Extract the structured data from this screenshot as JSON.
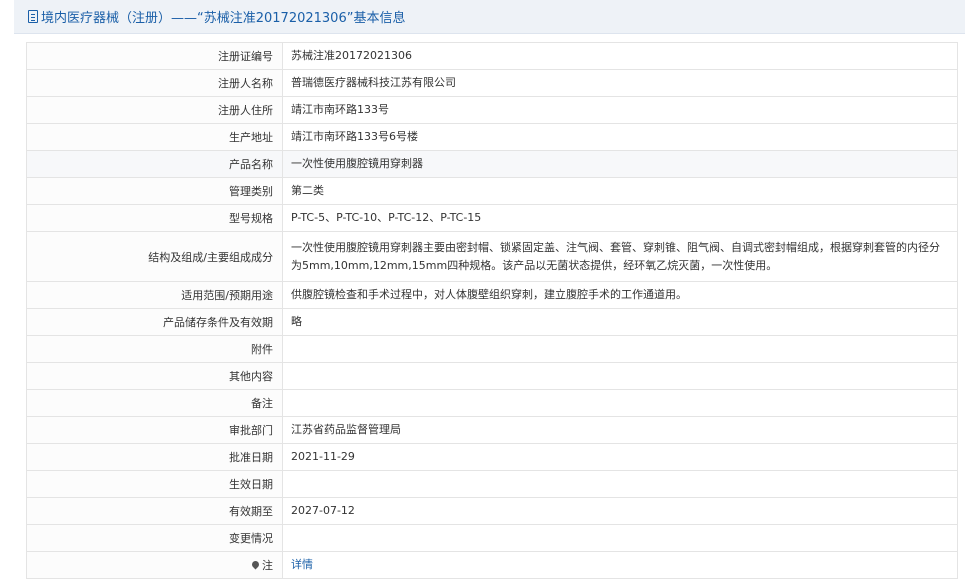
{
  "header": {
    "title": "境内医疗器械（注册）——“苏械注准20172021306”基本信息",
    "icon": "document-icon"
  },
  "rows": [
    {
      "label": "注册证编号",
      "value": "苏械注准20172021306"
    },
    {
      "label": "注册人名称",
      "value": "普瑞德医疗器械科技江苏有限公司"
    },
    {
      "label": "注册人住所",
      "value": "靖江市南环路133号"
    },
    {
      "label": "生产地址",
      "value": "靖江市南环路133号6号楼"
    },
    {
      "label": "产品名称",
      "value": "一次性使用腹腔镜用穿刺器"
    },
    {
      "label": "管理类别",
      "value": "第二类"
    },
    {
      "label": "型号规格",
      "value": "P-TC-5、P-TC-10、P-TC-12、P-TC-15"
    },
    {
      "label": "结构及组成/主要组成成分",
      "value": "一次性使用腹腔镜用穿刺器主要由密封帽、锁紧固定盖、注气阀、套管、穿刺锥、阻气阀、自调式密封帽组成，根据穿刺套管的内径分为5mm,10mm,12mm,15mm四种规格。该产品以无菌状态提供，经环氧乙烷灭菌，一次性使用。"
    },
    {
      "label": "适用范围/预期用途",
      "value": "供腹腔镜检查和手术过程中，对人体腹壁组织穿刺，建立腹腔手术的工作通道用。"
    },
    {
      "label": "产品储存条件及有效期",
      "value": "略"
    },
    {
      "label": "附件",
      "value": ""
    },
    {
      "label": "其他内容",
      "value": ""
    },
    {
      "label": "备注",
      "value": ""
    },
    {
      "label": "审批部门",
      "value": "江苏省药品监督管理局"
    },
    {
      "label": "批准日期",
      "value": "2021-11-29"
    },
    {
      "label": "生效日期",
      "value": ""
    },
    {
      "label": "有效期至",
      "value": "2027-07-12"
    },
    {
      "label": "变更情况",
      "value": ""
    }
  ],
  "note_row": {
    "label": "注",
    "link_text": "详情",
    "icon": "pin-icon"
  }
}
